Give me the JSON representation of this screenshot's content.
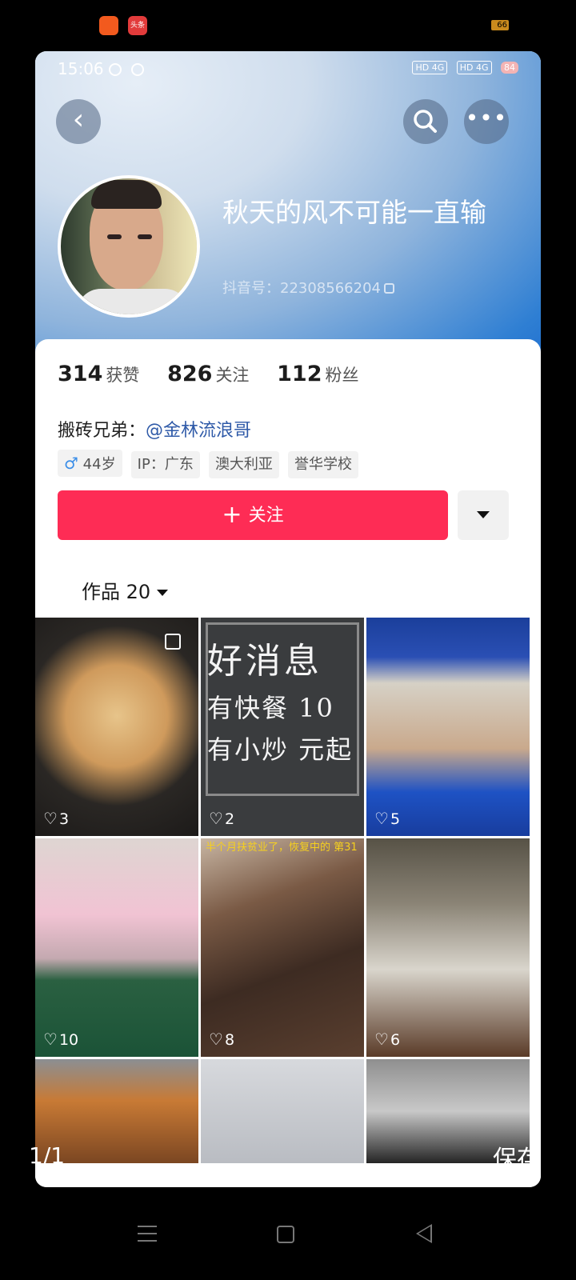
{
  "outer_status": {
    "badge_b_text": "头条",
    "battery": "66"
  },
  "inner_status": {
    "time": "15:06",
    "net1": "HD 4G",
    "net2": "HD 4G",
    "battery": "84"
  },
  "profile": {
    "nickname": "秋天的风不可能一直输",
    "douyin_id": "抖音号：22308566204",
    "stats": [
      {
        "num": "314",
        "label": "获赞"
      },
      {
        "num": "826",
        "label": "关注"
      },
      {
        "num": "112",
        "label": "粉丝"
      }
    ],
    "bio_prefix": "搬砖兄弟：",
    "bio_mention": "@金林流浪哥",
    "tags": {
      "gender_symbol": "♂",
      "age": "44岁",
      "ip": "IP：广东",
      "location": "澳大利亚",
      "school": "誉华学校"
    },
    "follow_label": "关注",
    "works_label": "作品 20"
  },
  "grid": {
    "tiles": [
      {
        "likes": "3"
      },
      {
        "likes": "2",
        "chalk_line1": "好消息",
        "chalk_line2": "有快餐 10",
        "chalk_line3": "有小炒 元起"
      },
      {
        "likes": "5"
      },
      {
        "likes": "10"
      },
      {
        "likes": "8",
        "caption": "半个月扶贫业了，恢复中的\n第31"
      },
      {
        "likes": "6"
      },
      {},
      {},
      {}
    ]
  },
  "viewer": {
    "counter": "1/1",
    "save_label": "保存"
  },
  "colors": {
    "follow": "#fe2c55",
    "mention": "#2f5aa8",
    "header_blue": "#2f7fd3"
  }
}
